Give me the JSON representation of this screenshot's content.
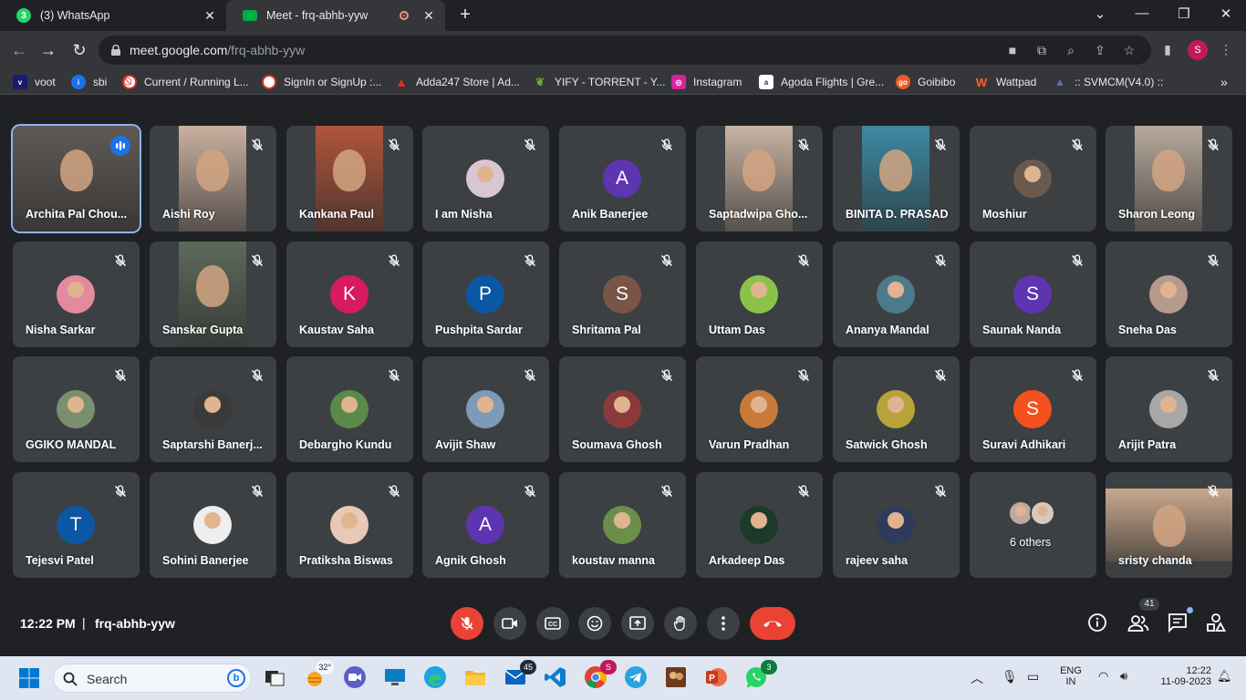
{
  "browser": {
    "tabs": [
      {
        "title": "(3) WhatsApp",
        "icon": "whatsapp-icon",
        "color": "#25d366",
        "active": false
      },
      {
        "title": "Meet - frq-abhb-yyw",
        "icon": "meet-icon",
        "color": "#00ac47",
        "active": true
      }
    ],
    "url_host": "meet.google.com",
    "url_path": "/frq-abhb-yyw",
    "profile_initial": "S"
  },
  "bookmarks": [
    {
      "label": "voot",
      "icon": "voot-icon",
      "color": "#1a1a6e"
    },
    {
      "label": "sbi",
      "icon": "sbi-icon",
      "color": "#1a73e8"
    },
    {
      "label": "Current / Running L...",
      "icon": "blocked-icon",
      "color": "#d93025"
    },
    {
      "label": "SignIn or SignUp :...",
      "icon": "blocked-icon",
      "color": "#d93025"
    },
    {
      "label": "Adda247 Store | Ad...",
      "icon": "adda-icon",
      "color": "#d93025"
    },
    {
      "label": "YIFY - TORRENT - Y...",
      "icon": "yify-icon",
      "color": "#6ab04c"
    },
    {
      "label": "Instagram",
      "icon": "instagram-icon",
      "color": "#d6249f"
    },
    {
      "label": "Agoda Flights | Gre...",
      "icon": "agoda-icon",
      "color": "#ffffff"
    },
    {
      "label": "Goibibo",
      "icon": "goibibo-icon",
      "color": "#f05a28"
    },
    {
      "label": "Wattpad",
      "icon": "wattpad-icon",
      "color": "#ff6122"
    },
    {
      "label": ":: SVMCM(V4.0) ::",
      "icon": "svmcm-icon",
      "color": "#5c6bc0"
    }
  ],
  "participants": [
    {
      "name": "Archita Pal Chou...",
      "kind": "video",
      "speaking": true,
      "bg": "#5f5a55"
    },
    {
      "name": "Aishi Roy",
      "kind": "video",
      "bg": "#c9b1a0"
    },
    {
      "name": "Kankana Paul",
      "kind": "video",
      "bg": "#b0553c"
    },
    {
      "name": "I am Nisha",
      "kind": "photo",
      "color": "#d8c6d3"
    },
    {
      "name": "Anik Banerjee",
      "kind": "letter",
      "letter": "A",
      "color": "#5e35b1"
    },
    {
      "name": "Saptadwipa Gho...",
      "kind": "video",
      "bg": "#c7b3a2"
    },
    {
      "name": "BINITA D. PRASAD",
      "kind": "video",
      "bg": "#3d8aa3"
    },
    {
      "name": "Moshiur",
      "kind": "photo",
      "color": "#6a5a4e"
    },
    {
      "name": "Sharon Leong",
      "kind": "video",
      "bg": "#b7a99c"
    },
    {
      "name": "Nisha Sarkar",
      "kind": "photo",
      "color": "#e48a9f"
    },
    {
      "name": "Sanskar Gupta",
      "kind": "video",
      "bg": "#5d6a5a"
    },
    {
      "name": "Kaustav Saha",
      "kind": "letter",
      "letter": "K",
      "color": "#d81b60"
    },
    {
      "name": "Pushpita Sardar",
      "kind": "letter",
      "letter": "P",
      "color": "#0b57a4"
    },
    {
      "name": "Shritama Pal",
      "kind": "letter",
      "letter": "S",
      "color": "#795548"
    },
    {
      "name": "Uttam Das",
      "kind": "photo",
      "color": "#8bc34a"
    },
    {
      "name": "Ananya Mandal",
      "kind": "photo",
      "color": "#4d7a8a"
    },
    {
      "name": "Saunak Nanda",
      "kind": "letter",
      "letter": "S",
      "color": "#5e35b1"
    },
    {
      "name": "Sneha Das",
      "kind": "photo",
      "color": "#b59a8d"
    },
    {
      "name": "GGIKO MANDAL",
      "kind": "photo",
      "color": "#7a8f6d"
    },
    {
      "name": "Saptarshi Banerj...",
      "kind": "photo",
      "color": "#3a3a3a"
    },
    {
      "name": "Debargho Kundu",
      "kind": "photo",
      "color": "#5a8a4a"
    },
    {
      "name": "Avijit Shaw",
      "kind": "photo",
      "color": "#7d9bb8"
    },
    {
      "name": "Soumava Ghosh",
      "kind": "photo",
      "color": "#8a3a3a"
    },
    {
      "name": "Varun Pradhan",
      "kind": "photo",
      "color": "#c77a3a"
    },
    {
      "name": "Satwick Ghosh",
      "kind": "photo",
      "color": "#b8a33a"
    },
    {
      "name": "Suravi Adhikari",
      "kind": "letter",
      "letter": "S",
      "color": "#f4511e"
    },
    {
      "name": "Arijit Patra",
      "kind": "photo",
      "color": "#a7a7a7"
    },
    {
      "name": "Tejesvi Patel",
      "kind": "letter",
      "letter": "T",
      "color": "#0b57a4"
    },
    {
      "name": "Sohini Banerjee",
      "kind": "photo",
      "color": "#eeeeee"
    },
    {
      "name": "Pratiksha Biswas",
      "kind": "photo",
      "color": "#e8c8b8"
    },
    {
      "name": "Agnik Ghosh",
      "kind": "letter",
      "letter": "A",
      "color": "#5e35b1"
    },
    {
      "name": "koustav manna",
      "kind": "photo",
      "color": "#6b8f4a"
    },
    {
      "name": "Arkadeep Das",
      "kind": "photo",
      "color": "#1b3a2a"
    },
    {
      "name": "rajeev saha",
      "kind": "photo",
      "color": "#2f3b5a"
    },
    {
      "name": "6 others",
      "kind": "others"
    },
    {
      "name": "sristy chanda",
      "kind": "video",
      "bg": "#c9a98f"
    }
  ],
  "bottom": {
    "time": "12:22 PM",
    "separator": "|",
    "meeting_code": "frq-abhb-yyw",
    "participant_count": "41"
  },
  "taskbar": {
    "search_label": "Search",
    "weather": "32°",
    "badges": {
      "mail": "45",
      "chrome": "S",
      "whatsapp": "3"
    },
    "lang_top": "ENG",
    "lang_bottom": "IN",
    "time": "12:22",
    "date": "11-09-2023"
  },
  "colors": {
    "meet_bg": "#202124",
    "tile_bg": "#3c4043",
    "end_call": "#ea4335",
    "speaking_border": "#8ab4f8"
  }
}
